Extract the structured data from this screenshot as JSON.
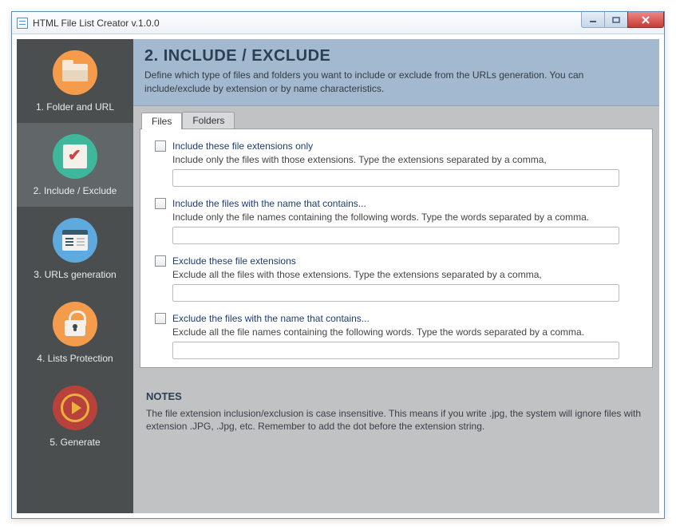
{
  "window": {
    "title": "HTML File List Creator v.1.0.0"
  },
  "sidebar": {
    "items": [
      {
        "label": "1. Folder and URL"
      },
      {
        "label": "2. Include / Exclude"
      },
      {
        "label": "3. URLs generation"
      },
      {
        "label": "4. Lists Protection"
      },
      {
        "label": "5. Generate"
      }
    ]
  },
  "header": {
    "title": "2. INCLUDE / EXCLUDE",
    "description": "Define which type of files and folders you want to include or exclude from the URLs generation. You can include/exclude by extension or by name characteristics."
  },
  "tabs": {
    "files": "Files",
    "folders": "Folders"
  },
  "options": {
    "include_ext": {
      "title": "Include these file extensions only",
      "desc": "Include only the files with those extensions. Type the extensions separated by a comma,",
      "value": ""
    },
    "include_name": {
      "title": "Include the files with the name that contains...",
      "desc": "Include only the file names containing the following words. Type the words separated by a comma.",
      "value": ""
    },
    "exclude_ext": {
      "title": "Exclude these file extensions",
      "desc": "Exclude all the files with those extensions. Type the extensions separated by a comma,",
      "value": ""
    },
    "exclude_name": {
      "title": "Exclude the files with the name that contains...",
      "desc": "Exclude all the file names containing the following words. Type the words separated by a comma.",
      "value": ""
    }
  },
  "notes": {
    "title": "NOTES",
    "body": "The file extension inclusion/exclusion is case insensitive. This means if you write .jpg, the system will ignore files with extension .JPG, .Jpg, etc. Remember to add the dot before the extension string."
  }
}
